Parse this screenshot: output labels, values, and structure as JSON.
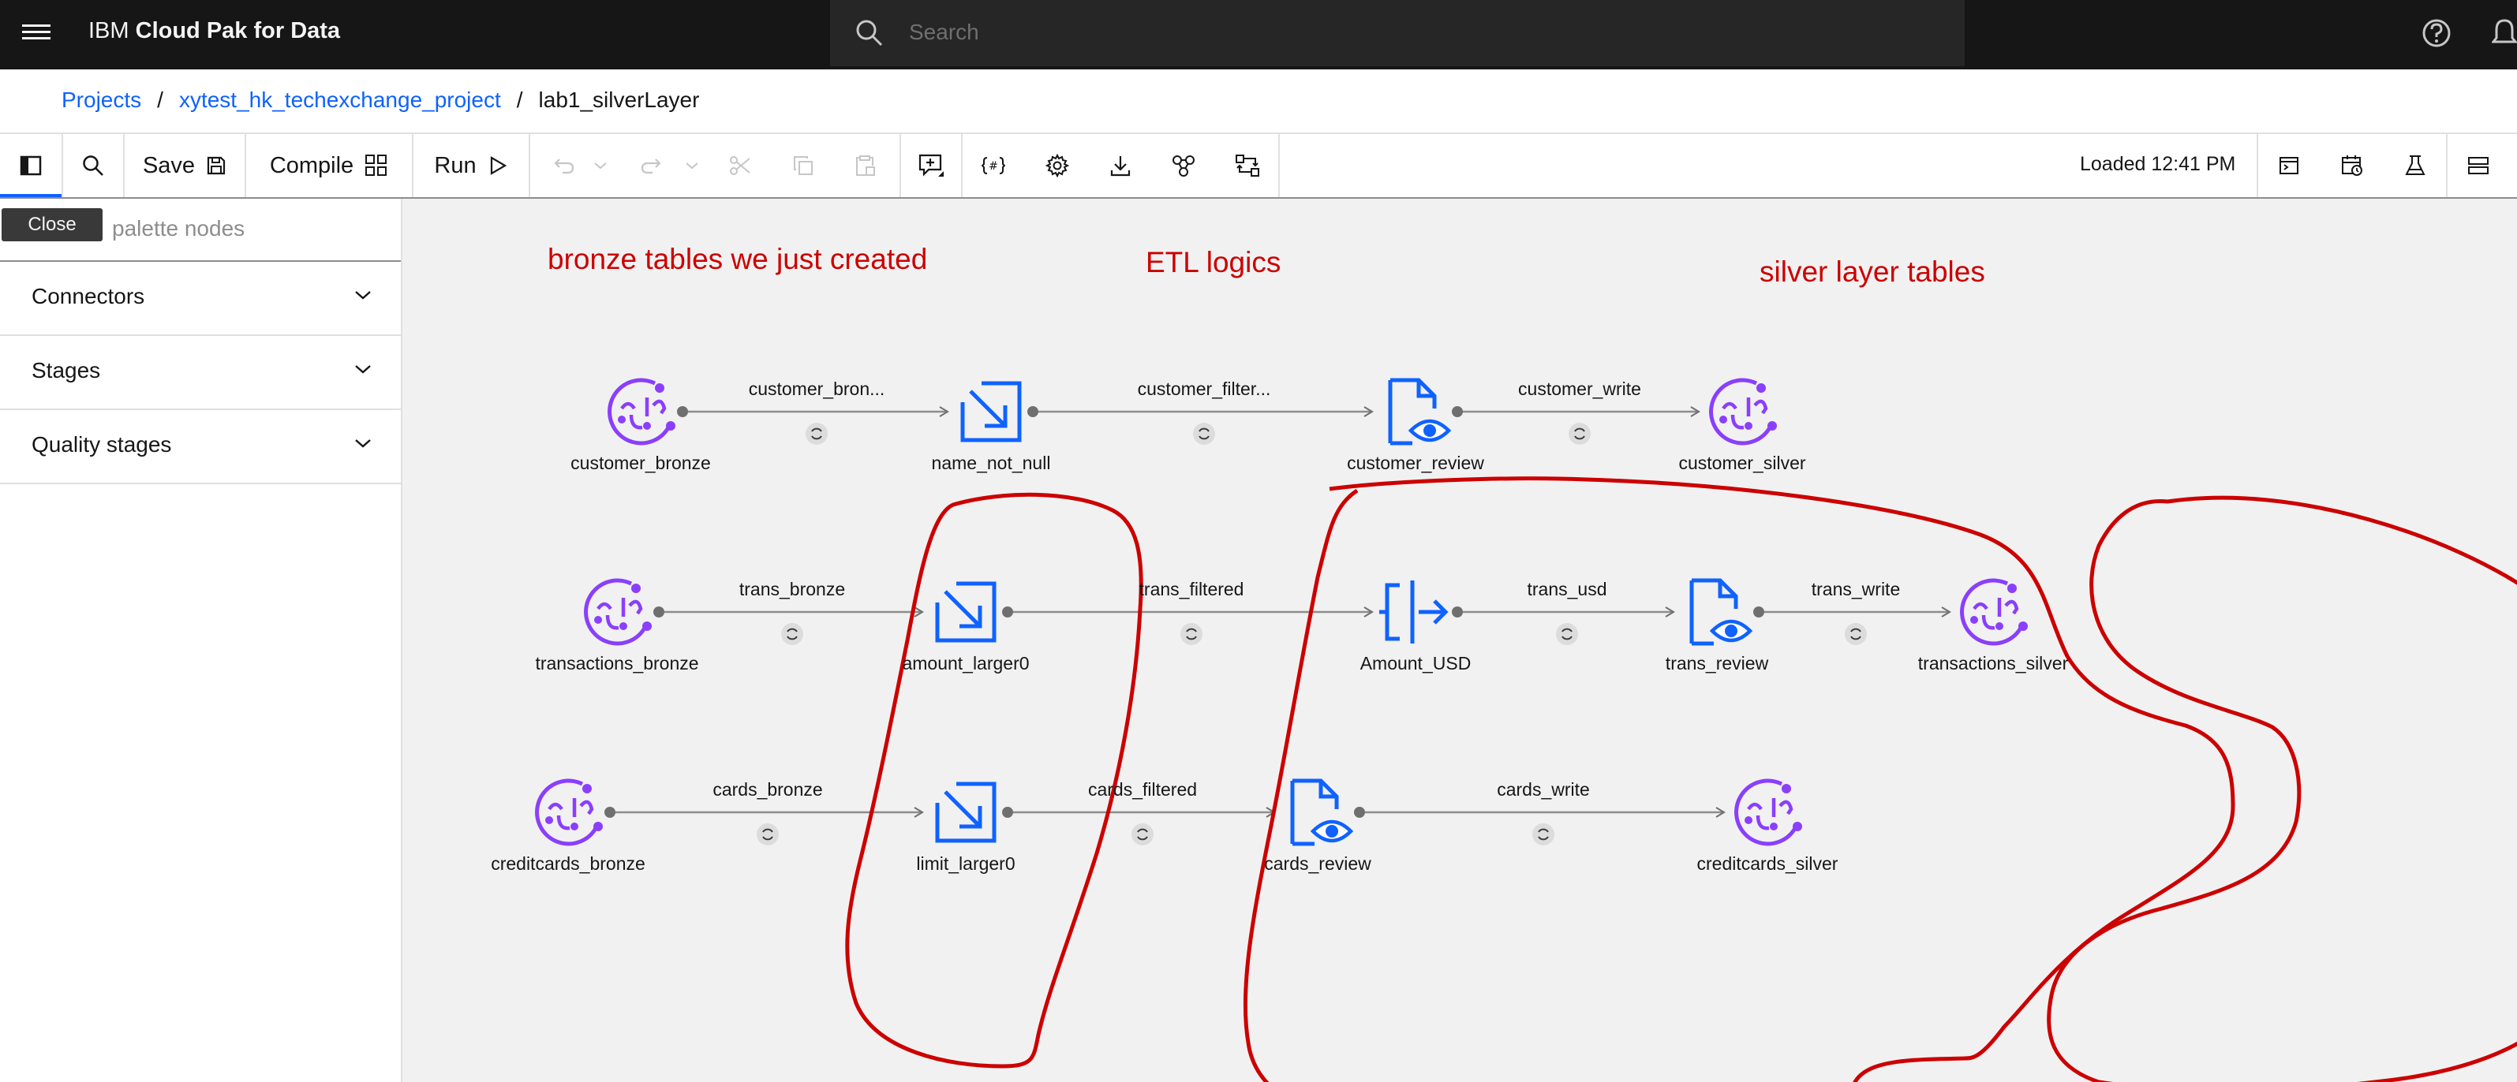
{
  "header": {
    "brand_prefix": "IBM",
    "brand_product": "Cloud Pak for Data",
    "search_placeholder": "Search"
  },
  "breadcrumb": {
    "projects": "Projects",
    "project": "xytest_hk_techexchange_project",
    "current": "lab1_silverLayer",
    "separator": "/"
  },
  "toolbar": {
    "save_label": "Save",
    "compile_label": "Compile",
    "run_label": "Run",
    "status": "Loaded 12:41 PM"
  },
  "palette": {
    "tooltip": "Close",
    "search_placeholder": "palette nodes",
    "sections": [
      "Connectors",
      "Stages",
      "Quality stages"
    ]
  },
  "flow": {
    "nodes": [
      {
        "id": "customer_bronze",
        "label": "customer_bronze",
        "icon": "connector-icon"
      },
      {
        "id": "name_not_null",
        "label": "name_not_null",
        "icon": "filter-icon"
      },
      {
        "id": "customer_review",
        "label": "customer_review",
        "icon": "peek-icon"
      },
      {
        "id": "customer_silver",
        "label": "customer_silver",
        "icon": "connector-icon"
      },
      {
        "id": "transactions_bronze",
        "label": "transactions_bronze",
        "icon": "connector-icon"
      },
      {
        "id": "amount_larger0",
        "label": "amount_larger0",
        "icon": "filter-icon"
      },
      {
        "id": "Amount_USD",
        "label": "Amount_USD",
        "icon": "transformer-icon"
      },
      {
        "id": "trans_review",
        "label": "trans_review",
        "icon": "peek-icon"
      },
      {
        "id": "transactions_silver",
        "label": "transactions_silver",
        "icon": "connector-icon"
      },
      {
        "id": "creditcards_bronze",
        "label": "creditcards_bronze",
        "icon": "connector-icon"
      },
      {
        "id": "limit_larger0",
        "label": "limit_larger0",
        "icon": "filter-icon"
      },
      {
        "id": "cards_review",
        "label": "cards_review",
        "icon": "peek-icon"
      },
      {
        "id": "creditcards_silver",
        "label": "creditcards_silver",
        "icon": "connector-icon"
      }
    ],
    "links": [
      {
        "label": "customer_bron..."
      },
      {
        "label": "customer_filter..."
      },
      {
        "label": "customer_write"
      },
      {
        "label": "trans_bronze"
      },
      {
        "label": "trans_filtered"
      },
      {
        "label": "trans_usd"
      },
      {
        "label": "trans_write"
      },
      {
        "label": "cards_bronze"
      },
      {
        "label": "cards_filtered"
      },
      {
        "label": "cards_write"
      }
    ]
  },
  "annotations": {
    "bronze": "bronze tables we just created",
    "etl": "ETL logics",
    "silver": "silver layer tables",
    "color": "#cc0000"
  },
  "colors": {
    "connector": "#8a3ffc",
    "stage": "#0f62fe",
    "link_text": "#0f62fe"
  }
}
